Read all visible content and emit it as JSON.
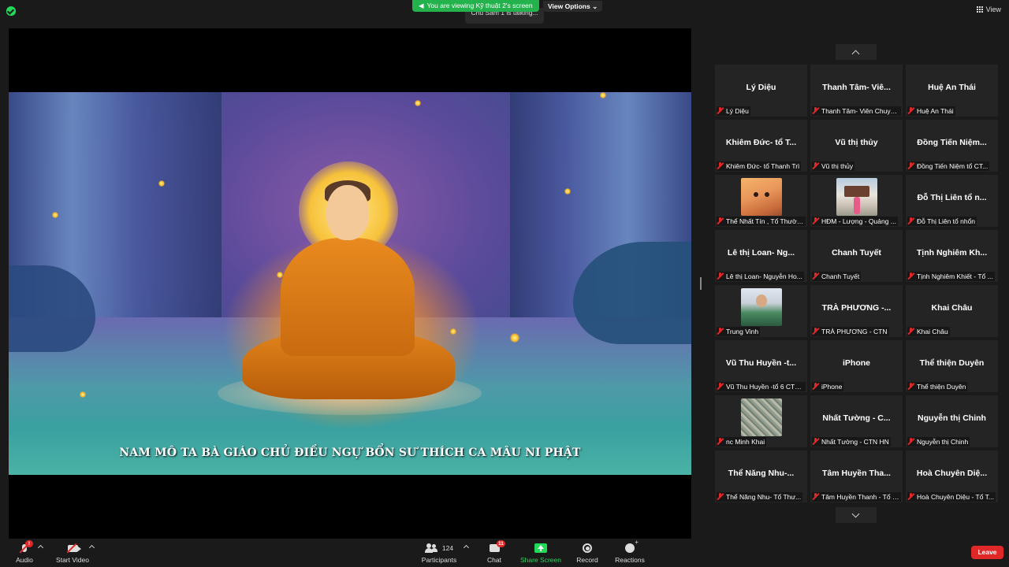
{
  "header": {
    "viewing_text": "You are viewing Kỹ thuật 2's screen",
    "talking_text": "Chú Sâm 1 is talking...",
    "view_options": "View Options",
    "view_label": "View"
  },
  "shared_screen": {
    "caption": "NAM MÔ TA BÀ GIÁO CHỦ ĐIỀU NGỰ BỔN SƯ THÍCH CA MÂU NI PHẬT"
  },
  "participants": [
    {
      "name": "Lý Diệu",
      "label": "Lý Diệu",
      "thumb": ""
    },
    {
      "name": "Thanh Tâm- Viê...",
      "label": "Thanh Tâm- Viên Chuyê...",
      "thumb": ""
    },
    {
      "name": "Huệ An Thái",
      "label": "Huệ An Thái",
      "thumb": ""
    },
    {
      "name": "Khiêm Đức- tổ T...",
      "label": "Khiêm Đức- tổ Thanh Trì",
      "thumb": ""
    },
    {
      "name": "Vũ thị thủy",
      "label": "Vũ thị thủy",
      "thumb": ""
    },
    {
      "name": "Đồng Tiến Niệm...",
      "label": "Đồng Tiến Niệm tổ CT...",
      "thumb": ""
    },
    {
      "name": "",
      "label": "Thể Nhất Tín , Tổ Thườn...",
      "thumb": "cat"
    },
    {
      "name": "",
      "label": "HĐM - Lượng - Quảng ...",
      "thumb": "gate"
    },
    {
      "name": "Đỗ Thị Liên tổ n...",
      "label": "Đỗ Thị Liên tổ nhổn",
      "thumb": ""
    },
    {
      "name": "Lê thị Loan- Ng...",
      "label": "Lê thị Loan- Nguyễn Ho...",
      "thumb": ""
    },
    {
      "name": "Chanh Tuyết",
      "label": "Chanh Tuyết",
      "thumb": ""
    },
    {
      "name": "Tịnh Nghiêm Kh...",
      "label": "Tịnh Nghiêm Khiết - Tổ ...",
      "thumb": ""
    },
    {
      "name": "",
      "label": "Trung Vinh",
      "thumb": "person"
    },
    {
      "name": "TRÀ PHƯƠNG -...",
      "label": "TRÀ PHƯƠNG - CTN",
      "thumb": ""
    },
    {
      "name": "Khai Châu",
      "label": "Khai Châu",
      "thumb": ""
    },
    {
      "name": "Vũ Thu Huyền -t...",
      "label": "Vũ Thu Huyền -tổ 6 CTN...",
      "thumb": ""
    },
    {
      "name": "iPhone",
      "label": "iPhone",
      "thumb": ""
    },
    {
      "name": "Thể thiện Duyên",
      "label": "Thể thiện Duyên",
      "thumb": ""
    },
    {
      "name": "",
      "label": "nc Minh Khai",
      "thumb": "map"
    },
    {
      "name": "Nhất Tường - C...",
      "label": "Nhất Tường - CTN HN",
      "thumb": ""
    },
    {
      "name": "Nguyễn thị Chinh",
      "label": "Nguyễn thị Chinh",
      "thumb": ""
    },
    {
      "name": "Thể Năng Nhu-...",
      "label": "Thể Năng Nhu- Tổ Thư...",
      "thumb": ""
    },
    {
      "name": "Tâm Huyền Tha...",
      "label": "Tâm Huyền Thanh - Tổ 6...",
      "thumb": ""
    },
    {
      "name": "Hoà Chuyên Diệ...",
      "label": "Hoà Chuyên Diệu - Tổ T...",
      "thumb": ""
    }
  ],
  "toolbar": {
    "audio": "Audio",
    "audio_badge": "!",
    "start_video": "Start Video",
    "participants": "Participants",
    "participants_count": "124",
    "chat": "Chat",
    "chat_badge": "11",
    "share_screen": "Share Screen",
    "record": "Record",
    "reactions": "Reactions",
    "leave": "Leave"
  },
  "colors": {
    "accent_green": "#23d959",
    "leave_red": "#e02828",
    "background": "#1a1a1a",
    "tile": "#242424"
  }
}
